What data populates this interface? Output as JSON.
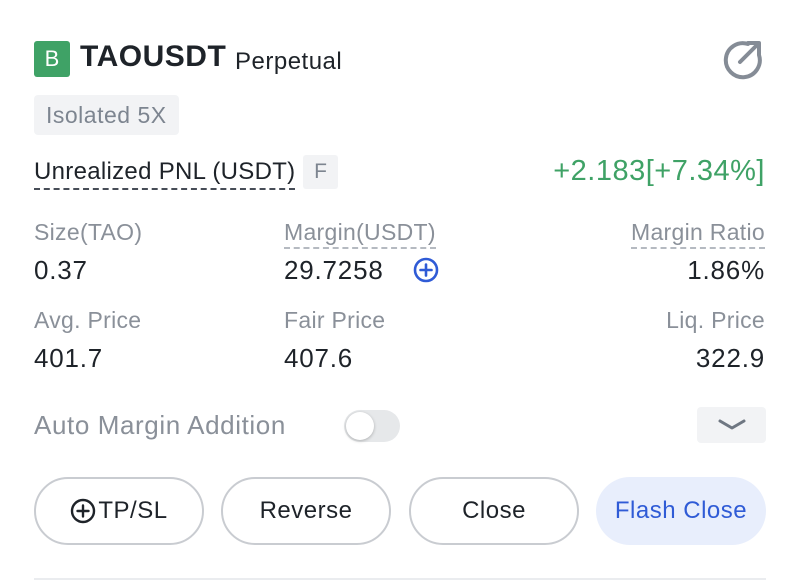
{
  "header": {
    "side_badge": "B",
    "symbol": "TAOUSDT",
    "contract_type": "Perpetual",
    "share_icon": "share-icon"
  },
  "mode_tag": "Isolated 5X",
  "pnl": {
    "label": "Unrealized PNL (USDT)",
    "tag": "F",
    "value": "+2.183[+7.34%]"
  },
  "stats": {
    "size_label": "Size(TAO)",
    "size_value": "0.37",
    "margin_label": "Margin(USDT)",
    "margin_value": "29.7258",
    "margin_ratio_label": "Margin Ratio",
    "margin_ratio_value": "1.86%",
    "avg_price_label": "Avg. Price",
    "avg_price_value": "401.7",
    "fair_price_label": "Fair Price",
    "fair_price_value": "407.6",
    "liq_price_label": "Liq. Price",
    "liq_price_value": "322.9"
  },
  "auto_margin": {
    "label": "Auto Margin Addition",
    "enabled": false
  },
  "actions": {
    "tpsl": "TP/SL",
    "reverse": "Reverse",
    "close": "Close",
    "flash_close": "Flash Close"
  },
  "colors": {
    "profit_green": "#3fa266",
    "link_blue": "#2f5bd6",
    "flash_bg": "#e8eefc"
  }
}
